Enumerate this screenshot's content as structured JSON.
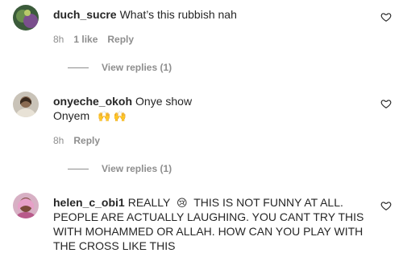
{
  "comments": [
    {
      "username": "duch_sucre",
      "text": "What’s this rubbish nah",
      "time": "8h",
      "likes": "1 like",
      "reply_label": "Reply",
      "view_replies": "View replies (1)"
    },
    {
      "username": "onyeche_okoh",
      "text_line1": "Onye show",
      "text_line2": "Onyem",
      "emojis": "🙌 🙌",
      "time": "8h",
      "reply_label": "Reply",
      "view_replies": "View replies (1)"
    },
    {
      "username": "helen_c_obi1",
      "text_part1": "REALLY",
      "emoji": "😢",
      "text_part2": "THIS IS NOT FUNNY AT ALL. PEOPLE ARE ACTUALLY LAUGHING. YOU CANT TRY THIS WITH MOHAMMED OR ALLAH. HOW CAN YOU PLAY WITH THE CROSS LIKE THIS"
    }
  ],
  "icons": {
    "like": "heart-outline-icon"
  },
  "colors": {
    "text": "#262626",
    "secondary": "#8e8e8e",
    "background": "#ffffff"
  }
}
